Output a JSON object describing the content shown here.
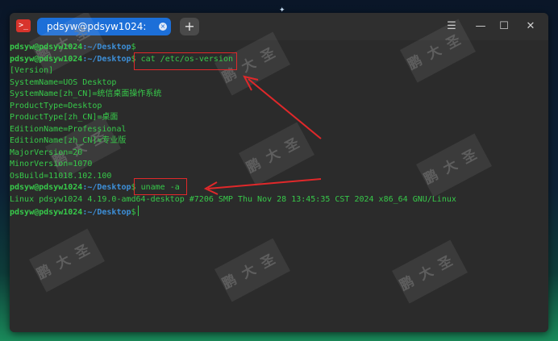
{
  "window": {
    "app_icon_glyph": ">_",
    "tab_title": "pdsyw@pdsyw1024: ~/Desktop",
    "new_tab_glyph": "+",
    "tab_close_glyph": "×",
    "controls": {
      "menu": "☰",
      "minimize": "—",
      "maximize": "☐",
      "close": "✕"
    }
  },
  "prompt": {
    "user": "pdsyw@pdsyw1024",
    "path": ":~/Desktop",
    "symbol": "$"
  },
  "terminal": {
    "cmd_os_version": "cat /etc/os-version",
    "output_os": [
      "[Version]",
      "SystemName=UOS Desktop",
      "SystemName[zh_CN]=统信桌面操作系统",
      "ProductType=Desktop",
      "ProductType[zh_CN]=桌面",
      "EditionName=Professional",
      "EditionName[zh_CN]=专业版",
      "MajorVersion=20",
      "MinorVersion=1070",
      "OsBuild=11018.102.100"
    ],
    "cmd_uname": "uname -a",
    "output_uname": "Linux pdsyw1024 4.19.0-amd64-desktop #7206 SMP Thu Nov 28 13:45:35 CST 2024 x86_64 GNU/Linux"
  },
  "watermark_text": "鹏大圣",
  "annotation_color": "#e0282a"
}
